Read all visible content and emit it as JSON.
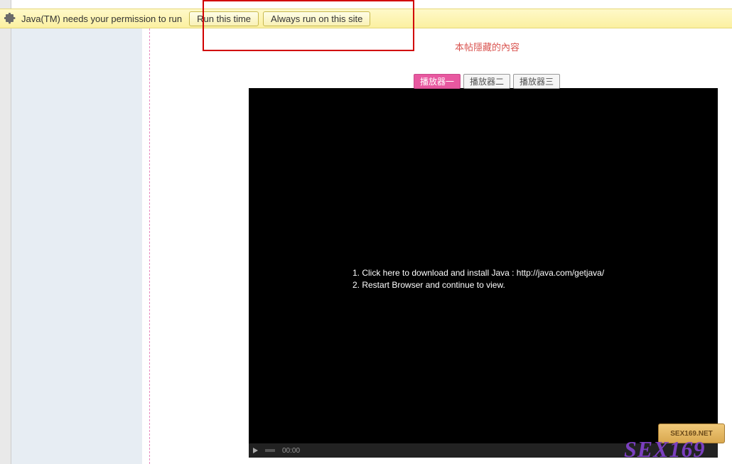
{
  "pluginBar": {
    "message": "Java(TM) needs your permission to run",
    "runOnceLabel": "Run this time",
    "runAlwaysLabel": "Always run on this site"
  },
  "hiddenNotice": "本帖隱藏的內容",
  "playerTabs": {
    "tab1": "播放器一",
    "tab2": "播放器二",
    "tab3": "播放器三"
  },
  "videoMessage": {
    "line1": "1. Click here to download and install Java : http://java.com/getjava/",
    "line2": "2. Restart Browser and continue to view."
  },
  "videoControls": {
    "time": "00:00"
  },
  "watermark": {
    "badge": "SEX169.NET",
    "text": "SEX169"
  }
}
